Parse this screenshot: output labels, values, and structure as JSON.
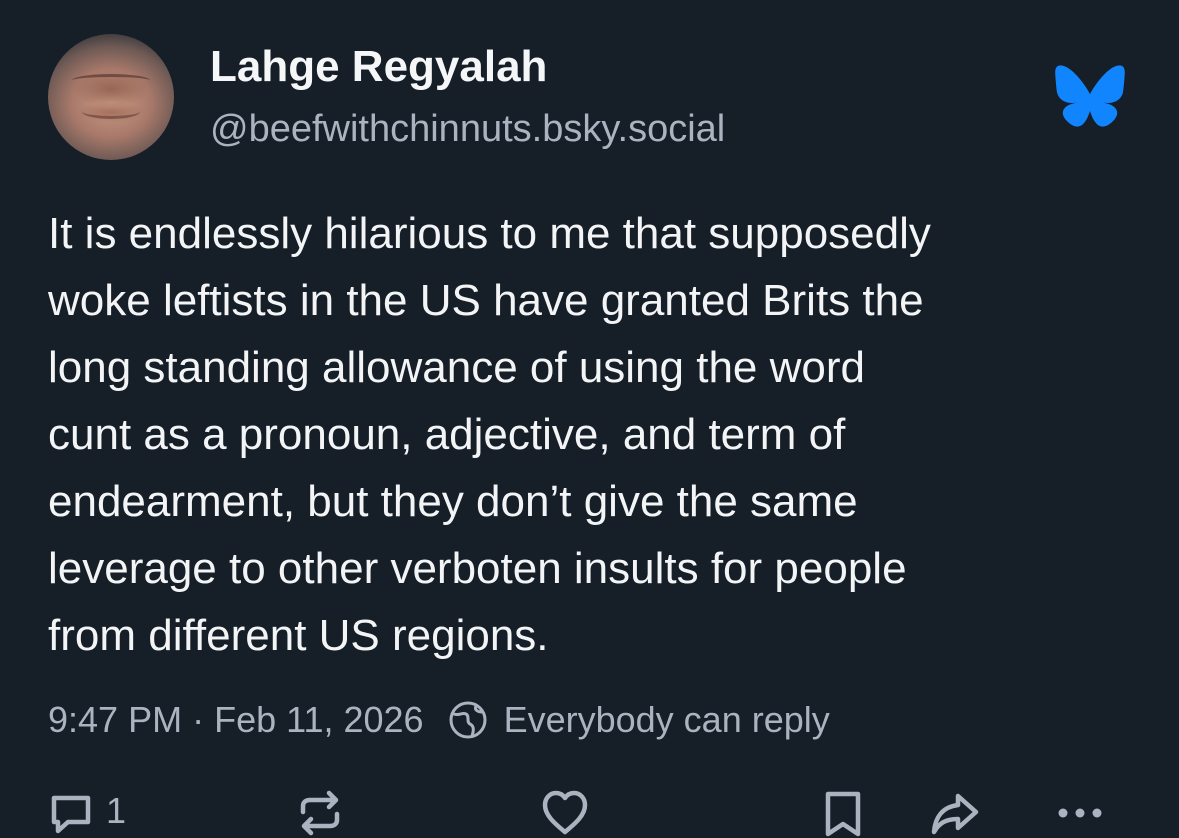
{
  "post": {
    "author": {
      "display_name": "Lahge Regyalah",
      "handle": "@beefwithchinnuts.bsky.social",
      "avatar_icon": "avatar-photo"
    },
    "text": "It is endlessly hilarious to me that supposedly\nwoke leftists in the US have granted Brits the\nlong standing allowance of using the word\ncunt as a pronoun, adjective, and term of\nendearment, but they don’t give the same\nleverage to other verboten insults for people\nfrom different US regions.",
    "time": "9:47 PM",
    "separator": "·",
    "date": "Feb 11, 2026",
    "reply_setting": "Everybody can reply",
    "brand_icon": "bluesky-butterfly-icon",
    "brand_color": "#1185fe"
  },
  "actions": {
    "reply_count": "1",
    "repost_count": "",
    "like_count": ""
  },
  "colors": {
    "background": "#161e27",
    "text_primary": "#f3f4f6",
    "text_secondary": "#aab4c0"
  }
}
